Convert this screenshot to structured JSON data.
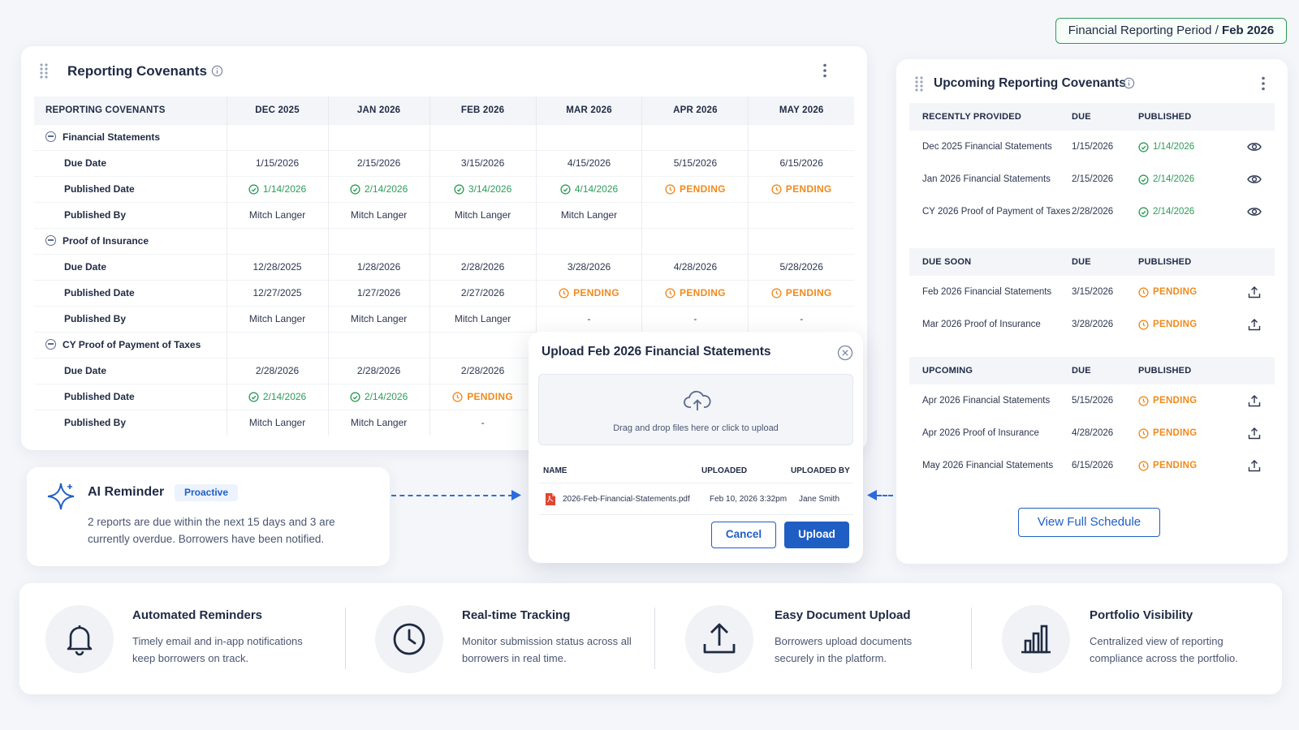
{
  "period_badge": {
    "label": "Financial Reporting Period",
    "separator": "/",
    "value": "Feb 2026"
  },
  "covenants": {
    "title": "Reporting Covenants",
    "columns": [
      "REPORTING COVENANTS",
      "DEC 2025",
      "JAN 2026",
      "FEB 2026",
      "MAR 2026",
      "APR 2026",
      "MAY 2026"
    ],
    "groups": [
      {
        "name": "Financial Statements",
        "rows": [
          {
            "label": "Due Date",
            "cells": [
              {
                "t": "1/15/2026"
              },
              {
                "t": "2/15/2026"
              },
              {
                "t": "3/15/2026"
              },
              {
                "t": "4/15/2026"
              },
              {
                "t": "5/15/2026"
              },
              {
                "t": "6/15/2026"
              }
            ]
          },
          {
            "label": "Published Date",
            "cells": [
              {
                "t": "1/14/2026",
                "s": "ok"
              },
              {
                "t": "2/14/2026",
                "s": "ok"
              },
              {
                "t": "3/14/2026",
                "s": "ok"
              },
              {
                "t": "4/14/2026",
                "s": "ok"
              },
              {
                "t": "PENDING",
                "s": "pending"
              },
              {
                "t": "PENDING",
                "s": "pending"
              }
            ]
          },
          {
            "label": "Published By",
            "cells": [
              {
                "t": "Mitch Langer"
              },
              {
                "t": "Mitch Langer"
              },
              {
                "t": "Mitch Langer"
              },
              {
                "t": "Mitch Langer"
              },
              {
                "t": ""
              },
              {
                "t": ""
              }
            ]
          }
        ]
      },
      {
        "name": "Proof of Insurance",
        "rows": [
          {
            "label": "Due Date",
            "cells": [
              {
                "t": "12/28/2025"
              },
              {
                "t": "1/28/2026"
              },
              {
                "t": "2/28/2026"
              },
              {
                "t": "3/28/2026"
              },
              {
                "t": "4/28/2026"
              },
              {
                "t": "5/28/2026"
              }
            ]
          },
          {
            "label": "Published Date",
            "cells": [
              {
                "t": "12/27/2025"
              },
              {
                "t": "1/27/2026"
              },
              {
                "t": "2/27/2026"
              },
              {
                "t": "PENDING",
                "s": "pending"
              },
              {
                "t": "PENDING",
                "s": "pending"
              },
              {
                "t": "PENDING",
                "s": "pending"
              }
            ]
          },
          {
            "label": "Published By",
            "cells": [
              {
                "t": "Mitch Langer"
              },
              {
                "t": "Mitch Langer"
              },
              {
                "t": "Mitch Langer"
              },
              {
                "t": "-"
              },
              {
                "t": "-"
              },
              {
                "t": "-"
              }
            ]
          }
        ]
      },
      {
        "name": "CY Proof of Payment of Taxes",
        "rows": [
          {
            "label": "Due Date",
            "cells": [
              {
                "t": "2/28/2026"
              },
              {
                "t": "2/28/2026"
              },
              {
                "t": "2/28/2026"
              },
              {
                "t": ""
              },
              {
                "t": ""
              },
              {
                "t": ""
              }
            ]
          },
          {
            "label": "Published Date",
            "cells": [
              {
                "t": "2/14/2026",
                "s": "ok"
              },
              {
                "t": "2/14/2026",
                "s": "ok"
              },
              {
                "t": "PENDING",
                "s": "pending"
              },
              {
                "t": ""
              },
              {
                "t": ""
              },
              {
                "t": ""
              }
            ]
          },
          {
            "label": "Published By",
            "cells": [
              {
                "t": "Mitch Langer"
              },
              {
                "t": "Mitch Langer"
              },
              {
                "t": "-"
              },
              {
                "t": ""
              },
              {
                "t": ""
              },
              {
                "t": ""
              }
            ]
          }
        ]
      }
    ]
  },
  "upcoming": {
    "title": "Upcoming Reporting Covenants",
    "sections": [
      {
        "headers": [
          "RECENTLY PROVIDED",
          "DUE",
          "PUBLISHED"
        ],
        "rows": [
          {
            "name": "Dec 2025 Financial Statements",
            "due": "1/15/2026",
            "published": "1/14/2026",
            "status": "ok",
            "action": "eye-icon"
          },
          {
            "name": "Jan 2026 Financial Statements",
            "due": "2/15/2026",
            "published": "2/14/2026",
            "status": "ok",
            "action": "eye-icon"
          },
          {
            "name": "CY 2026 Proof of Payment of Taxes",
            "due": "2/28/2026",
            "published": "2/14/2026",
            "status": "ok",
            "action": "eye-icon"
          }
        ]
      },
      {
        "headers": [
          "DUE SOON",
          "DUE",
          "PUBLISHED"
        ],
        "rows": [
          {
            "name": "Feb 2026 Financial Statements",
            "due": "3/15/2026",
            "published": "PENDING",
            "status": "pending",
            "action": "upload-icon"
          },
          {
            "name": "Mar 2026 Proof of Insurance",
            "due": "3/28/2026",
            "published": "PENDING",
            "status": "pending",
            "action": "upload-icon"
          }
        ]
      },
      {
        "headers": [
          "UPCOMING",
          "DUE",
          "PUBLISHED"
        ],
        "rows": [
          {
            "name": "Apr 2026 Financial Statements",
            "due": "5/15/2026",
            "published": "PENDING",
            "status": "pending",
            "action": "upload-icon"
          },
          {
            "name": "Apr 2026 Proof of Insurance",
            "due": "4/28/2026",
            "published": "PENDING",
            "status": "pending",
            "action": "upload-icon"
          },
          {
            "name": "May 2026 Financial Statements",
            "due": "6/15/2026",
            "published": "PENDING",
            "status": "pending",
            "action": "upload-icon"
          }
        ]
      }
    ],
    "view_button": "View Full Schedule"
  },
  "ai_reminder": {
    "title": "AI Reminder",
    "badge": "Proactive",
    "text": "2 reports are due within the next 15 days and 3 are currently overdue. Borrowers have been notified."
  },
  "upload_modal": {
    "title": "Upload Feb 2026 Financial Statements",
    "drop_text": "Drag and drop files here or click to upload",
    "columns": [
      "NAME",
      "UPLOADED",
      "UPLOADED BY"
    ],
    "file": {
      "name": "2026-Feb-Financial-Statements.pdf",
      "uploaded": "Feb 10, 2026 3:32pm",
      "uploaded_by": "Jane Smith"
    },
    "cancel_label": "Cancel",
    "upload_label": "Upload"
  },
  "features": [
    {
      "icon": "bell-icon",
      "title": "Automated Reminders",
      "desc": "Timely email and in-app notifications keep borrowers on track."
    },
    {
      "icon": "clock-icon",
      "title": "Real-time Tracking",
      "desc": "Monitor submission status across all borrowers in real time."
    },
    {
      "icon": "upload-icon",
      "title": "Easy Document Upload",
      "desc": "Borrowers upload documents securely in the platform."
    },
    {
      "icon": "bar-chart-icon",
      "title": "Portfolio Visibility",
      "desc": "Centralized view of reporting compliance across the portfolio."
    }
  ],
  "colors": {
    "accent": "#1f5fc4",
    "success": "#2e9c5a",
    "pending": "#f08a1c",
    "text": "#1f2a44"
  }
}
